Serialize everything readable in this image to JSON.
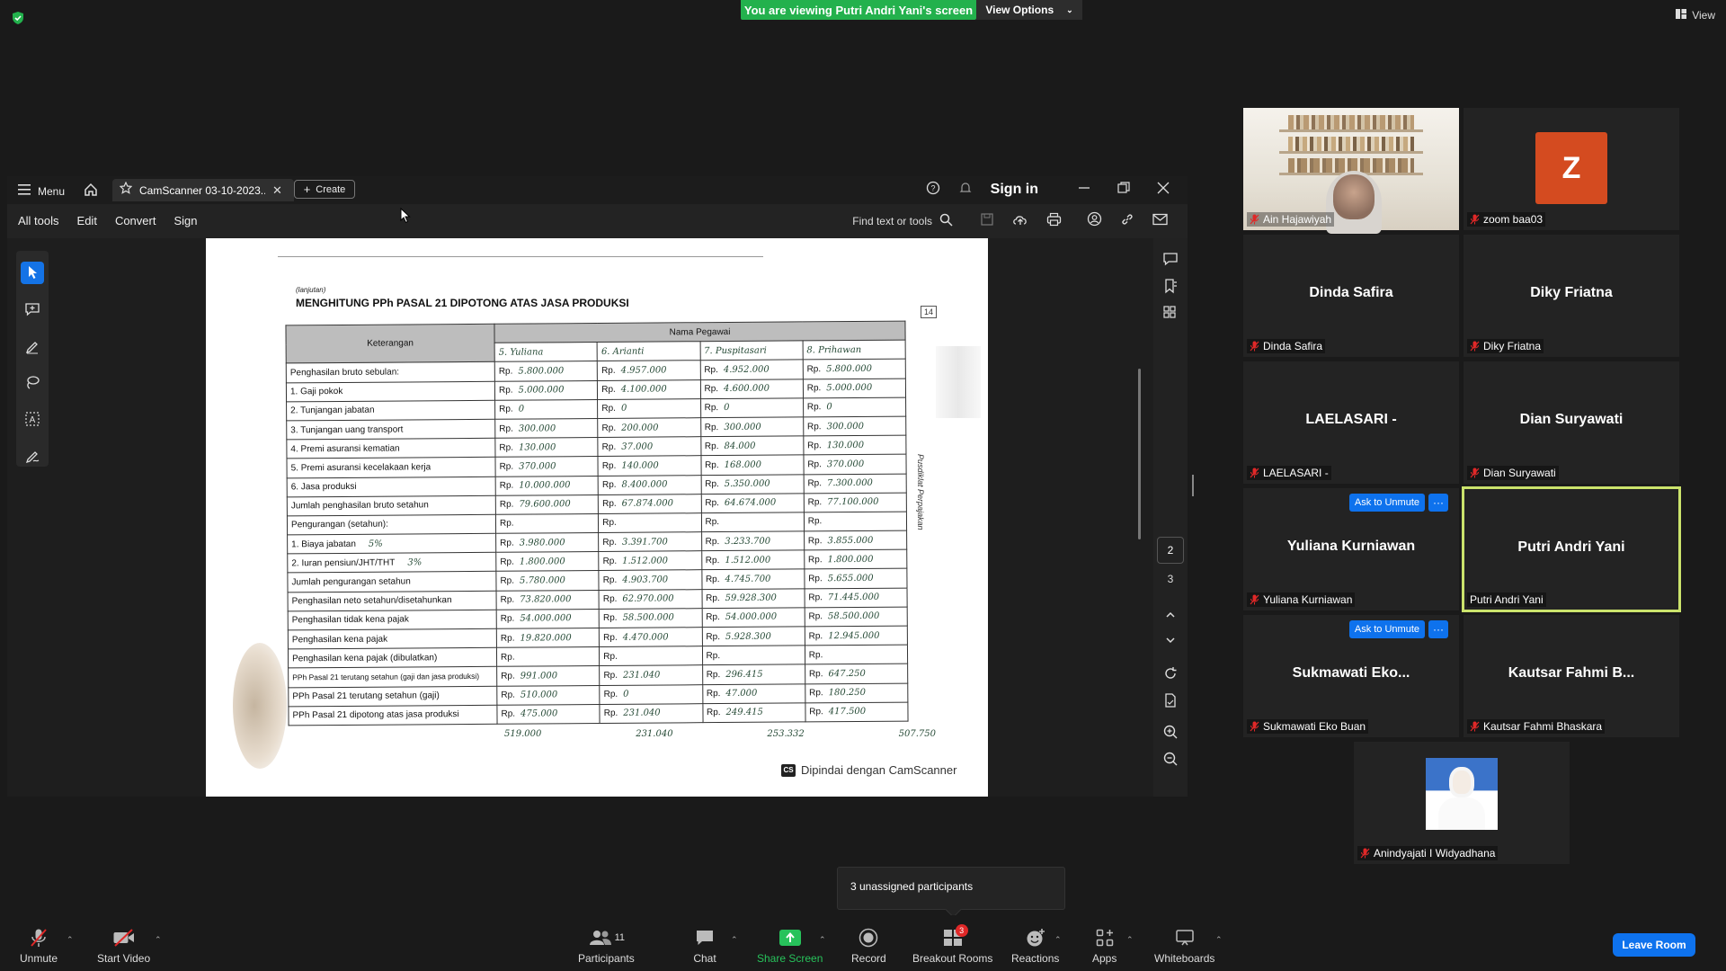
{
  "banner": {
    "viewing_text": "You are viewing Putri Andri Yani's screen",
    "view_options": "View Options",
    "view_label": "View"
  },
  "acrobat": {
    "menu_label": "Menu",
    "tab_title": "CamScanner 03-10-2023...",
    "create_label": "Create",
    "sign_in": "Sign in",
    "menu_items": [
      "All tools",
      "Edit",
      "Convert",
      "Sign"
    ],
    "find_text": "Find text or tools",
    "page_current": "2",
    "page_next": "3"
  },
  "document": {
    "lanjutan": "(lanjutan)",
    "title": "MENGHITUNG PPh PASAL 21 DIPOTONG ATAS JASA PRODUKSI",
    "header_keterangan": "Keterangan",
    "header_nama_pegawai": "Nama Pegawai",
    "employees": [
      "5. Yuliana",
      "6. Arianti",
      "7. Puspitasari",
      "8. Prihawan"
    ],
    "rp": "Rp.",
    "rows": [
      {
        "label": "Penghasilan bruto sebulan:",
        "vals": [
          "5.800.000",
          "4.957.000",
          "4.952.000",
          "5.800.000"
        ]
      },
      {
        "label": "1. Gaji pokok",
        "vals": [
          "5.000.000",
          "4.100.000",
          "4.600.000",
          "5.000.000"
        ]
      },
      {
        "label": "2. Tunjangan jabatan",
        "vals": [
          "0",
          "0",
          "0",
          "0"
        ]
      },
      {
        "label": "3. Tunjangan uang transport",
        "vals": [
          "300.000",
          "200.000",
          "300.000",
          "300.000"
        ]
      },
      {
        "label": "4. Premi asuransi kematian",
        "vals": [
          "130.000",
          "37.000",
          "84.000",
          "130.000"
        ]
      },
      {
        "label": "5. Premi asuransi kecelakaan kerja",
        "vals": [
          "370.000",
          "140.000",
          "168.000",
          "370.000"
        ]
      },
      {
        "label": "6. Jasa produksi",
        "vals": [
          "10.000.000",
          "8.400.000",
          "5.350.000",
          "7.300.000"
        ]
      },
      {
        "label": "Jumlah penghasilan bruto setahun",
        "vals": [
          "79.600.000",
          "67.874.000",
          "64.674.000",
          "77.100.000"
        ]
      },
      {
        "label": "Pengurangan (setahun):",
        "vals": [
          "",
          "",
          "",
          ""
        ]
      },
      {
        "label": "1. Biaya jabatan",
        "note": "5%",
        "vals": [
          "3.980.000",
          "3.391.700",
          "3.233.700",
          "3.855.000"
        ]
      },
      {
        "label": "2. Iuran pensiun/JHT/THT",
        "note": "3%",
        "vals": [
          "1.800.000",
          "1.512.000",
          "1.512.000",
          "1.800.000"
        ]
      },
      {
        "label": "Jumlah pengurangan setahun",
        "vals": [
          "5.780.000",
          "4.903.700",
          "4.745.700",
          "5.655.000"
        ]
      },
      {
        "label": "Penghasilan neto setahun/disetahunkan",
        "vals": [
          "73.820.000",
          "62.970.000",
          "59.928.300",
          "71.445.000"
        ]
      },
      {
        "label": "Penghasilan tidak kena pajak",
        "vals": [
          "54.000.000",
          "58.500.000",
          "54.000.000",
          "58.500.000"
        ]
      },
      {
        "label": "Penghasilan kena pajak",
        "vals": [
          "19.820.000",
          "4.470.000",
          "5.928.300",
          "12.945.000"
        ]
      },
      {
        "label": "Penghasilan kena pajak (dibulatkan)",
        "vals": [
          "",
          "",
          "",
          ""
        ]
      },
      {
        "label": "PPh Pasal 21 terutang setahun (gaji dan jasa produksi)",
        "vals": [
          "991.000",
          "231.040",
          "296.415",
          "647.250"
        ]
      },
      {
        "label": "PPh Pasal 21 terutang setahun (gaji)",
        "vals": [
          "510.000",
          "0",
          "47.000",
          "180.250"
        ]
      },
      {
        "label": "PPh Pasal 21 dipotong atas jasa produksi",
        "vals": [
          "475.000",
          "231.040",
          "249.415",
          "417.500"
        ]
      }
    ],
    "below_vals": [
      "519.000",
      "231.040",
      "253.332",
      "507.750"
    ],
    "side_stamp": "Pusdiklat Perpajakan",
    "camscanner": "Dipindai dengan CamScanner",
    "cs_logo": "CS"
  },
  "participants": [
    {
      "id": "ain",
      "name": "Ain Hajawiyah",
      "muted": true,
      "video": true
    },
    {
      "id": "zoom",
      "name": "zoom baa03",
      "avatar_letter": "Z",
      "muted": true
    },
    {
      "id": "dinda",
      "name": "Dinda Safira",
      "display": "Dinda Safira",
      "muted": true
    },
    {
      "id": "diky",
      "name": "Diky Friatna",
      "display": "Diky Friatna",
      "muted": true
    },
    {
      "id": "laela",
      "name": "LAELASARI -",
      "display": "LAELASARI -",
      "muted": true
    },
    {
      "id": "dian",
      "name": "Dian Suryawati",
      "display": "Dian Suryawati",
      "muted": true
    },
    {
      "id": "yuliana",
      "name": "Yuliana Kurniawan",
      "display": "Yuliana Kurniawan",
      "muted": true,
      "ask_unmute": "Ask to Unmute"
    },
    {
      "id": "putri",
      "name": "Putri Andri Yani",
      "display": "Putri Andri Yani",
      "muted": false,
      "active": true
    },
    {
      "id": "sukma",
      "name": "Sukmawati  Eko Buan",
      "display": "Sukmawati  Eko...",
      "muted": true,
      "ask_unmute": "Ask to Unmute"
    },
    {
      "id": "kautsar",
      "name": "Kautsar Fahmi Bhaskara",
      "display": "Kautsar Fahmi B...",
      "muted": true
    },
    {
      "id": "anindya",
      "name": "Anindyajati I Widyadhana",
      "muted": true,
      "photo": true
    }
  ],
  "tooltip": {
    "text": "3 unassigned participants"
  },
  "toolbar": {
    "unmute": "Unmute",
    "start_video": "Start Video",
    "participants": "Participants",
    "participants_count": "11",
    "chat": "Chat",
    "share_screen": "Share Screen",
    "record": "Record",
    "breakout_rooms": "Breakout Rooms",
    "breakout_badge": "3",
    "reactions": "Reactions",
    "apps": "Apps",
    "whiteboards": "Whiteboards",
    "leave_room": "Leave Room",
    "more_dots": "···"
  },
  "colors": {
    "share_green": "#27c25b",
    "zoom_blue": "#0e72ed",
    "active_outline": "#cbe36c",
    "muted_red": "#e02828"
  }
}
